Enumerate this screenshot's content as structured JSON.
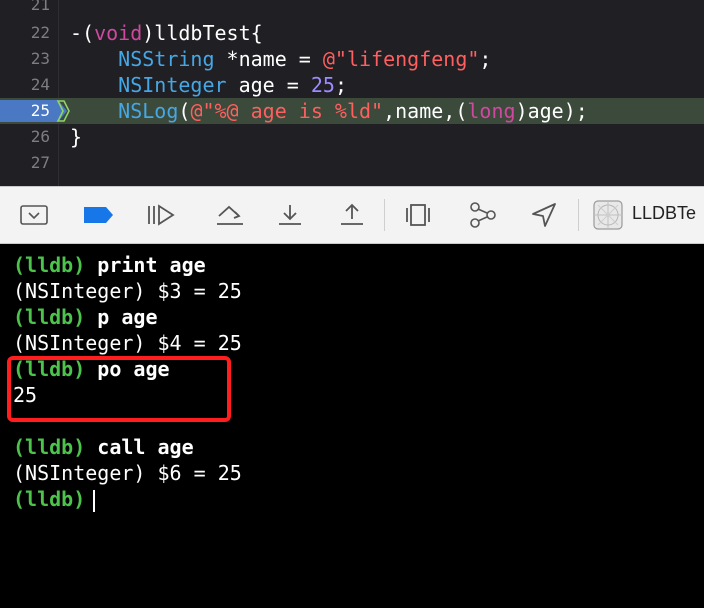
{
  "editor": {
    "lines": [
      {
        "num": "21"
      },
      {
        "num": "22",
        "tokens": [
          "-(",
          "void",
          ")lldbTest{"
        ]
      },
      {
        "num": "23",
        "tokens": [
          "    ",
          "NSString",
          " *name = ",
          "@\"lifengfeng\"",
          ";"
        ]
      },
      {
        "num": "24",
        "tokens": [
          "    ",
          "NSInteger",
          " age = ",
          "25",
          ";"
        ]
      },
      {
        "num": "25",
        "tokens": [
          "    ",
          "NSLog",
          "(",
          "@\"%@ age is %ld\"",
          ",name,(",
          "long",
          ")age);"
        ]
      },
      {
        "num": "26",
        "tokens": [
          "}"
        ]
      },
      {
        "num": "27"
      }
    ]
  },
  "toolbar": {
    "buttons": [
      {
        "name": "hide-console-button",
        "icon": "panel-toggle-icon"
      },
      {
        "name": "breakpoints-toggle-button",
        "icon": "breakpoint-icon"
      },
      {
        "name": "continue-button",
        "icon": "continue-icon"
      },
      {
        "name": "step-over-button",
        "icon": "step-over-icon"
      },
      {
        "name": "step-into-button",
        "icon": "step-into-icon"
      },
      {
        "name": "step-out-button",
        "icon": "step-out-icon"
      },
      {
        "name": "view-debugger-button",
        "icon": "view-hierarchy-icon"
      },
      {
        "name": "memory-graph-button",
        "icon": "memory-graph-icon"
      },
      {
        "name": "simulate-location-button",
        "icon": "location-icon"
      },
      {
        "name": "target-button",
        "icon": "app-target-icon"
      }
    ],
    "target_label": "LLDBTe"
  },
  "console": {
    "lines": [
      {
        "prompt": "(lldb)",
        "command": " print age"
      },
      {
        "output": "(NSInteger) $3 = 25"
      },
      {
        "prompt": "(lldb)",
        "command": " p age"
      },
      {
        "output": "(NSInteger) $4 = 25"
      },
      {
        "prompt": "(lldb)",
        "command": " po age"
      },
      {
        "output": "25"
      },
      {
        "output": ""
      },
      {
        "prompt": "(lldb)",
        "command": " call age"
      },
      {
        "output": "(NSInteger) $6 = 25"
      },
      {
        "prompt": "(lldb)",
        "command": ""
      }
    ]
  },
  "colors": {
    "keyword": "#d0489f",
    "type": "#45a7e6",
    "string": "#ff5f5f",
    "number": "#9b8cff",
    "prompt": "#4cc44c",
    "highlight_row": "#3b4a3b",
    "callout": "#ff1d1d"
  }
}
